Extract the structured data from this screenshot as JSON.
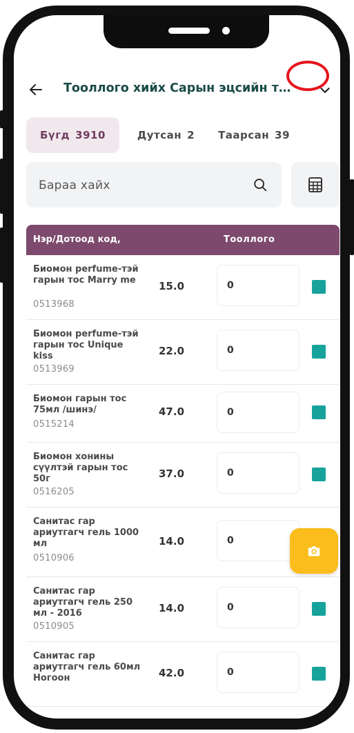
{
  "header": {
    "title": "Тооллого хийх Сарын эцсийн то..."
  },
  "tabs": [
    {
      "label": "Бүгд",
      "count": "3910",
      "active": true
    },
    {
      "label": "Дутсан",
      "count": "2",
      "active": false
    },
    {
      "label": "Таарсан",
      "count": "39",
      "active": false
    }
  ],
  "search": {
    "placeholder": "Бараа хайх"
  },
  "table": {
    "col_name": "Нэр/Дотоод код,",
    "col_count": "Тооллого",
    "rows": [
      {
        "name": "Биомон perfume-тэй гарын тос Marry me",
        "code": "0513968",
        "qty": "15.0",
        "count": "0",
        "checked": true
      },
      {
        "name": "Биомон perfume-тэй гарын тос Unique kiss",
        "code": "0513969",
        "qty": "22.0",
        "count": "0",
        "checked": true
      },
      {
        "name": "Биомон гарын тос 75мл /шинэ/",
        "code": "0515214",
        "qty": "47.0",
        "count": "0",
        "checked": true
      },
      {
        "name": "Биомон хонины сүүлтэй гарын тос 50г",
        "code": "0516205",
        "qty": "37.0",
        "count": "0",
        "checked": true
      },
      {
        "name": "Санитас гар ариутгагч гель 1000 мл",
        "code": "0510906",
        "qty": "14.0",
        "count": "0",
        "checked": false
      },
      {
        "name": "Санитас гар ариутгагч гель 250 мл - 2016",
        "code": "0510905",
        "qty": "14.0",
        "count": "0",
        "checked": true
      },
      {
        "name": "Санитас гар ариутгагч гель 60мл Ногоон",
        "code": "",
        "qty": "42.0",
        "count": "0",
        "checked": true
      }
    ]
  },
  "colors": {
    "accent": "#7d4a6e",
    "title": "#1a4b48",
    "check": "#17a39b",
    "fab": "#fbbd1b",
    "highlight_ring": "#e6141c"
  },
  "icons": {
    "back": "arrow-left-icon",
    "dropdown": "chevron-down-icon",
    "search": "search-icon",
    "calculator": "calculator-icon",
    "camera": "camera-icon"
  }
}
